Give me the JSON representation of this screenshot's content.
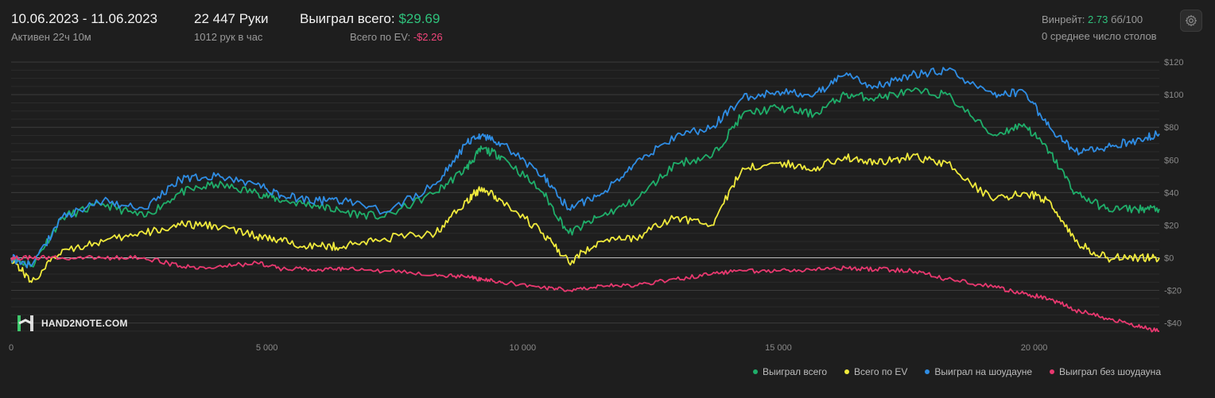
{
  "header": {
    "date_range": "10.06.2023 - 11.06.2023",
    "active_time": "Активен 22ч 10м",
    "hands": "22 447 Руки",
    "hands_per_hour": "1012 рук в час",
    "won_label": "Выиграл всего:",
    "won_value": "$29.69",
    "ev_label": "Всего по EV:",
    "ev_value": "-$2.26",
    "winrate_label": "Винрейт:",
    "winrate_value": "2.73",
    "winrate_unit": "бб/100",
    "avg_tables": "0 среднее число столов",
    "settings_icon": "gear-icon"
  },
  "logo": {
    "text": "HAND2NOTE.COM",
    "icon": "hand2note-logo-icon"
  },
  "legend": [
    {
      "label": "Выиграл всего",
      "color": "#1fae6a"
    },
    {
      "label": "Всего по EV",
      "color": "#f0ea3c"
    },
    {
      "label": "Выиграл на шоудауне",
      "color": "#2f8de4"
    },
    {
      "label": "Выиграл без шоудауна",
      "color": "#e8386f"
    }
  ],
  "chart_data": {
    "type": "line",
    "x_ticks": [
      "0",
      "5 000",
      "10 000",
      "15 000",
      "20 000"
    ],
    "x_tick_values": [
      0,
      5000,
      10000,
      15000,
      20000
    ],
    "xlim": [
      0,
      22447
    ],
    "y_ticks": [
      "$120",
      "$100",
      "$80",
      "$60",
      "$40",
      "$20",
      "$0",
      "-$20",
      "-$40"
    ],
    "y_tick_values": [
      120,
      100,
      80,
      60,
      40,
      20,
      0,
      -20,
      -40
    ],
    "ylim": [
      -47,
      122
    ],
    "grid": true,
    "legend_position": "bottom-right",
    "x": [
      0,
      400,
      1000,
      1800,
      2600,
      3300,
      4000,
      4800,
      5300,
      6000,
      6500,
      7300,
      8300,
      8900,
      9200,
      9600,
      10400,
      10900,
      11500,
      12200,
      13000,
      13700,
      14300,
      15000,
      15700,
      16300,
      16900,
      17600,
      18300,
      19200,
      19800,
      20300,
      20800,
      21400,
      22000,
      22447
    ],
    "series": [
      {
        "name": "Выиграл всего",
        "color": "#1fae6a",
        "values": [
          0,
          -5,
          25,
          33,
          25,
          40,
          45,
          40,
          35,
          32,
          28,
          25,
          40,
          55,
          67,
          62,
          40,
          15,
          25,
          35,
          58,
          62,
          88,
          92,
          88,
          100,
          98,
          102,
          100,
          75,
          82,
          65,
          40,
          30,
          30,
          30
        ]
      },
      {
        "name": "Всего по EV",
        "color": "#f0ea3c",
        "values": [
          0,
          -15,
          5,
          10,
          15,
          20,
          20,
          13,
          10,
          7,
          7,
          12,
          15,
          35,
          43,
          35,
          15,
          -3,
          10,
          12,
          25,
          20,
          55,
          58,
          55,
          62,
          58,
          62,
          58,
          35,
          40,
          35,
          10,
          0,
          0,
          0
        ]
      },
      {
        "name": "Выиграл на шоудауне",
        "color": "#2f8de4",
        "values": [
          0,
          -5,
          25,
          35,
          30,
          48,
          50,
          45,
          38,
          35,
          35,
          28,
          45,
          70,
          75,
          70,
          50,
          30,
          38,
          58,
          75,
          80,
          98,
          102,
          100,
          112,
          105,
          112,
          115,
          100,
          102,
          80,
          65,
          68,
          72,
          76
        ]
      },
      {
        "name": "Выиграл без шоудауна",
        "color": "#e8386f",
        "values": [
          0,
          0,
          0,
          0,
          0,
          -5,
          -6,
          -3,
          -7,
          -7,
          -7,
          -8,
          -10,
          -12,
          -13,
          -15,
          -18,
          -20,
          -17,
          -17,
          -13,
          -10,
          -8,
          -8,
          -7,
          -6,
          -7,
          -8,
          -13,
          -18,
          -22,
          -25,
          -32,
          -37,
          -42,
          -45
        ]
      }
    ]
  }
}
